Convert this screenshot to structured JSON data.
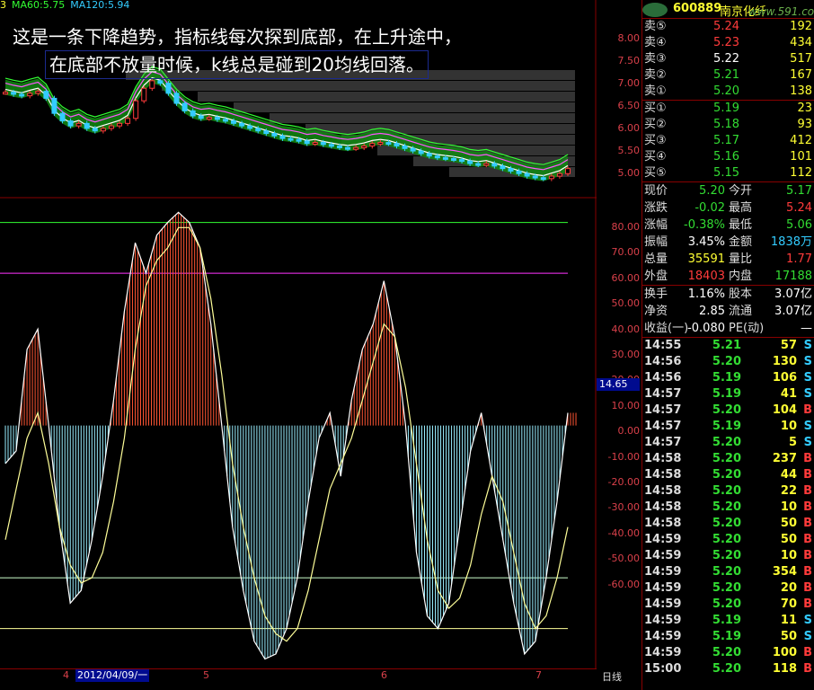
{
  "ma_header": {
    "ma_partial": "3",
    "ma60_label": "MA60:",
    "ma60_value": "5.75",
    "ma120_label": "MA120:",
    "ma120_value": "5.94"
  },
  "annotation": {
    "line1": "这是一条下降趋势，指标线每次探到底部，在上升途中，",
    "line2": "在底部不放量时候，k线总是碰到20均线回落。"
  },
  "price_axis": [
    "8.00",
    "7.50",
    "7.00",
    "6.50",
    "6.00",
    "5.50",
    "5.00"
  ],
  "indicator_axis": [
    "80.00",
    "70.00",
    "60.00",
    "50.00",
    "40.00",
    "30.00",
    "20.00",
    "10.00",
    "0.00",
    "-10.00",
    "-20.00",
    "-30.00",
    "-40.00",
    "-50.00",
    "-60.00"
  ],
  "indicator_cursor": "14.65",
  "date_axis": {
    "ticks": [
      "4",
      "5",
      "6",
      "7"
    ],
    "cursor_date": "2012/04/09/一",
    "period": "日线"
  },
  "stock": {
    "code": "600889",
    "name": "南京化纤",
    "logo_text": "www.591.com"
  },
  "sell_orders": [
    {
      "label": "卖⑤",
      "price": "5.24",
      "vol": "192",
      "color": "red"
    },
    {
      "label": "卖④",
      "price": "5.23",
      "vol": "434",
      "color": "red"
    },
    {
      "label": "卖③",
      "price": "5.22",
      "vol": "517",
      "color": "white"
    },
    {
      "label": "卖②",
      "price": "5.21",
      "vol": "167",
      "color": "green"
    },
    {
      "label": "卖①",
      "price": "5.20",
      "vol": "138",
      "color": "green"
    }
  ],
  "buy_orders": [
    {
      "label": "买①",
      "price": "5.19",
      "vol": "23",
      "color": "green"
    },
    {
      "label": "买②",
      "price": "5.18",
      "vol": "93",
      "color": "green"
    },
    {
      "label": "买③",
      "price": "5.17",
      "vol": "412",
      "color": "green"
    },
    {
      "label": "买④",
      "price": "5.16",
      "vol": "101",
      "color": "green"
    },
    {
      "label": "买⑤",
      "price": "5.15",
      "vol": "112",
      "color": "green"
    }
  ],
  "quote": [
    {
      "l1": "现价",
      "v1": "5.20",
      "c1": "green",
      "l2": "今开",
      "v2": "5.17",
      "c2": "green"
    },
    {
      "l1": "涨跌",
      "v1": "-0.02",
      "c1": "green",
      "l2": "最高",
      "v2": "5.24",
      "c2": "red"
    },
    {
      "l1": "涨幅",
      "v1": "-0.38%",
      "c1": "green",
      "l2": "最低",
      "v2": "5.06",
      "c2": "green"
    },
    {
      "l1": "振幅",
      "v1": "3.45%",
      "c1": "white",
      "l2": "金额",
      "v2": "1838万",
      "c2": "cyan"
    },
    {
      "l1": "总量",
      "v1": "35591",
      "c1": "yellow",
      "l2": "量比",
      "v2": "1.77",
      "c2": "red"
    },
    {
      "l1": "外盘",
      "v1": "18403",
      "c1": "red",
      "l2": "内盘",
      "v2": "17188",
      "c2": "green"
    }
  ],
  "fundamentals": [
    {
      "l1": "换手",
      "v1": "1.16%",
      "l2": "股本",
      "v2": "3.07亿"
    },
    {
      "l1": "净资",
      "v1": "2.85",
      "l2": "流通",
      "v2": "3.07亿"
    },
    {
      "l1": "收益(一)",
      "v1": "-0.080",
      "l2": "PE(动)",
      "v2": "—"
    }
  ],
  "ticks": [
    {
      "t": "14:55",
      "p": "5.21",
      "v": "57",
      "s": "S"
    },
    {
      "t": "14:56",
      "p": "5.20",
      "v": "130",
      "s": "S"
    },
    {
      "t": "14:56",
      "p": "5.19",
      "v": "106",
      "s": "S"
    },
    {
      "t": "14:57",
      "p": "5.19",
      "v": "41",
      "s": "S"
    },
    {
      "t": "14:57",
      "p": "5.20",
      "v": "104",
      "s": "B"
    },
    {
      "t": "14:57",
      "p": "5.19",
      "v": "10",
      "s": "S"
    },
    {
      "t": "14:57",
      "p": "5.20",
      "v": "5",
      "s": "S"
    },
    {
      "t": "14:58",
      "p": "5.20",
      "v": "237",
      "s": "B"
    },
    {
      "t": "14:58",
      "p": "5.20",
      "v": "44",
      "s": "B"
    },
    {
      "t": "14:58",
      "p": "5.20",
      "v": "22",
      "s": "B"
    },
    {
      "t": "14:58",
      "p": "5.20",
      "v": "10",
      "s": "B"
    },
    {
      "t": "14:58",
      "p": "5.20",
      "v": "50",
      "s": "B"
    },
    {
      "t": "14:59",
      "p": "5.20",
      "v": "50",
      "s": "B"
    },
    {
      "t": "14:59",
      "p": "5.20",
      "v": "10",
      "s": "B"
    },
    {
      "t": "14:59",
      "p": "5.20",
      "v": "354",
      "s": "B"
    },
    {
      "t": "14:59",
      "p": "5.20",
      "v": "20",
      "s": "B"
    },
    {
      "t": "14:59",
      "p": "5.20",
      "v": "70",
      "s": "B"
    },
    {
      "t": "14:59",
      "p": "5.19",
      "v": "11",
      "s": "S"
    },
    {
      "t": "14:59",
      "p": "5.19",
      "v": "50",
      "s": "S"
    },
    {
      "t": "14:59",
      "p": "5.20",
      "v": "100",
      "s": "B"
    },
    {
      "t": "15:00",
      "p": "5.20",
      "v": "118",
      "s": "B"
    }
  ],
  "chart_data": [
    {
      "type": "candlestick",
      "title": "",
      "ylim": [
        4.8,
        8.2
      ],
      "closes": [
        6.72,
        6.68,
        6.65,
        6.7,
        6.74,
        6.6,
        6.3,
        6.15,
        6.05,
        6.1,
        6.0,
        5.95,
        6.0,
        6.05,
        6.1,
        6.2,
        6.55,
        6.8,
        6.95,
        6.9,
        6.7,
        6.5,
        6.35,
        6.25,
        6.2,
        6.22,
        6.18,
        6.15,
        6.1,
        6.05,
        6.0,
        5.95,
        5.9,
        5.85,
        5.8,
        5.78,
        5.75,
        5.7,
        5.72,
        5.68,
        5.65,
        5.62,
        5.6,
        5.62,
        5.65,
        5.7,
        5.72,
        5.7,
        5.65,
        5.6,
        5.55,
        5.5,
        5.45,
        5.42,
        5.4,
        5.38,
        5.35,
        5.3,
        5.28,
        5.3,
        5.25,
        5.2,
        5.15,
        5.1,
        5.05,
        5.02,
        5.0,
        5.05,
        5.1,
        5.2
      ]
    },
    {
      "type": "line",
      "title": "",
      "ylim": [
        -95,
        88
      ],
      "reference_lines": [
        80,
        60,
        -60,
        -80
      ],
      "series": [
        {
          "values": [
            -15,
            -10,
            30,
            38,
            0,
            -40,
            -70,
            -65,
            -45,
            -20,
            10,
            45,
            72,
            60,
            75,
            80,
            84,
            80,
            70,
            40,
            0,
            -40,
            -65,
            -85,
            -92,
            -90,
            -80,
            -60,
            -30,
            -5,
            5,
            -20,
            10,
            30,
            40,
            57,
            35,
            0,
            -50,
            -75,
            -80,
            -70,
            -40,
            -10,
            5,
            -20,
            -45,
            -70,
            -90,
            -85,
            -60,
            -30,
            5
          ]
        },
        {
          "values": [
            -45,
            -25,
            -5,
            5,
            -15,
            -40,
            -55,
            -62,
            -60,
            -50,
            -30,
            -5,
            30,
            55,
            65,
            70,
            78,
            78,
            70,
            50,
            20,
            -15,
            -40,
            -60,
            -75,
            -82,
            -85,
            -80,
            -65,
            -45,
            -25,
            -15,
            -5,
            10,
            25,
            40,
            35,
            15,
            -15,
            -45,
            -65,
            -72,
            -68,
            -55,
            -35,
            -20,
            -30,
            -50,
            -70,
            -80,
            -75,
            -60,
            -40
          ]
        }
      ]
    }
  ]
}
